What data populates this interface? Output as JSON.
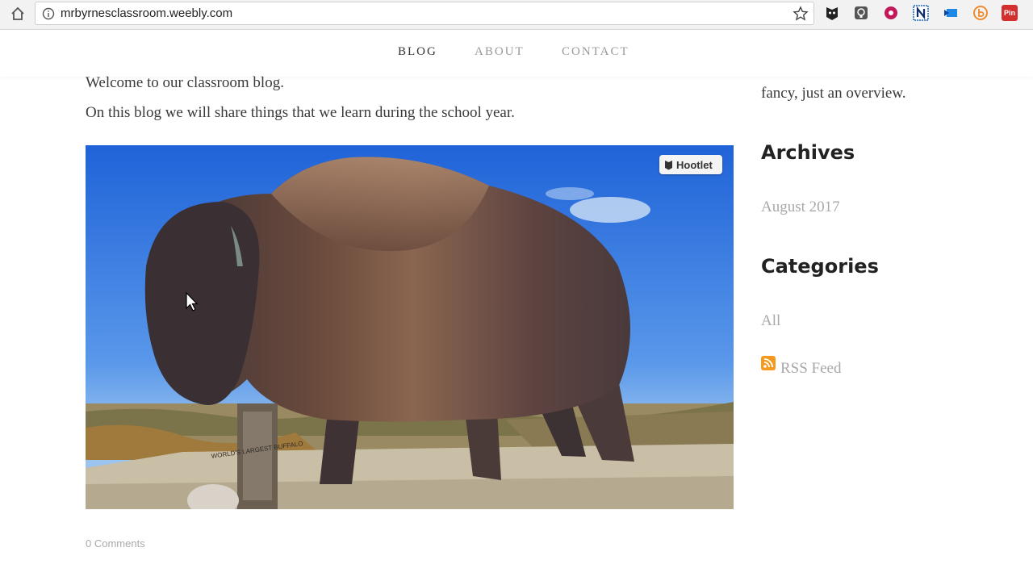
{
  "browser": {
    "url": "mrbyrnesclassroom.weebly.com",
    "extensions": [
      "hootsuite-owl-icon",
      "lightbulb-icon",
      "donut-icon",
      "n-extension-icon",
      "screencast-icon",
      "b-extension-icon",
      "pinterest-icon"
    ],
    "pin_label": "Pin"
  },
  "nav": {
    "items": [
      {
        "label": "BLOG"
      },
      {
        "label": "ABOUT"
      },
      {
        "label": "CONTACT"
      }
    ]
  },
  "post": {
    "line1": "Welcome to our classroom blog.",
    "line2": "On this blog we will share things that we learn during the school year.",
    "image_badge": "Hootlet",
    "sign_text": "WORLD'S LARGEST BUFFALO",
    "comments": "0 Comments"
  },
  "sidebar": {
    "fragment": "fancy, just an overview.",
    "archives_heading": "Archives",
    "archive_item": "August 2017",
    "categories_heading": "Categories",
    "category_item": "All",
    "rss_label": "RSS Feed"
  },
  "colors": {
    "active_nav": "#333333",
    "inactive_nav": "#9a9a9a",
    "rss_orange": "#f39a1f"
  }
}
